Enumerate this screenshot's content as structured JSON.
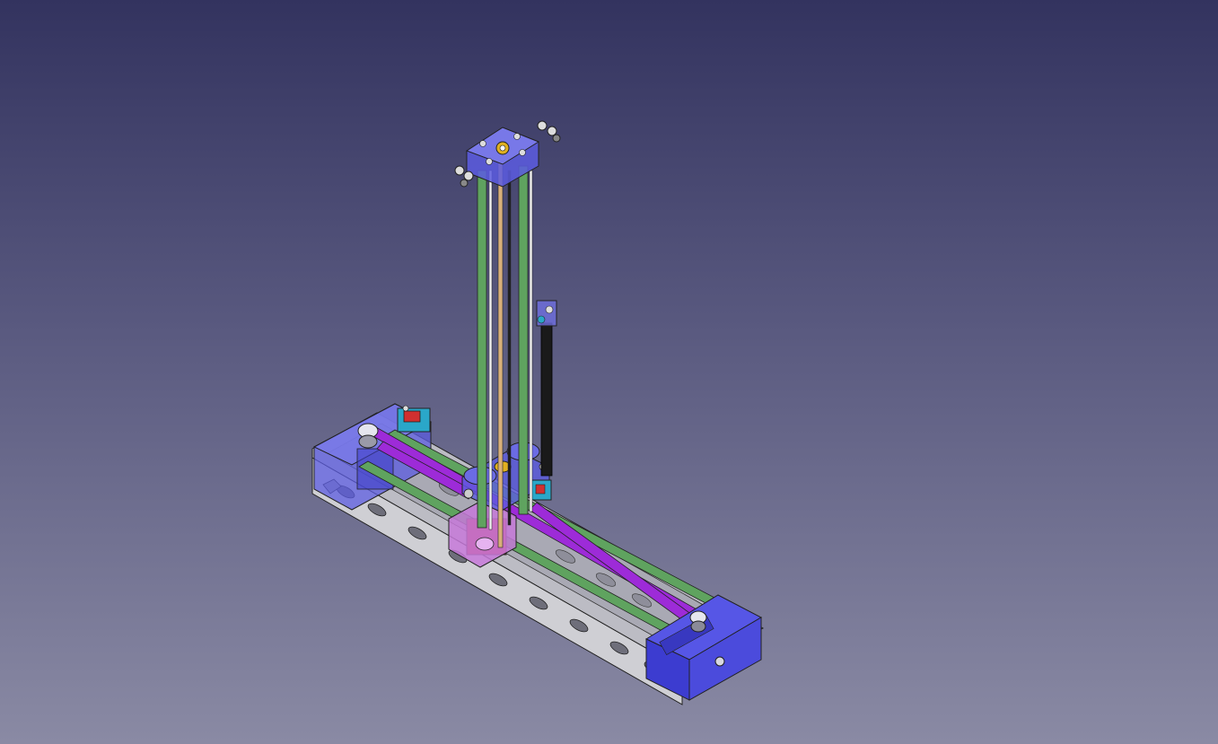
{
  "viewport": {
    "background_top": "#33335f",
    "background_bottom": "#8a8aa4"
  },
  "model": {
    "part_colors": {
      "frame_rail": "#c9c9cf",
      "enclosure_blue": "#4b4bdc",
      "transparent_blue": "#6f6fe0",
      "linear_rod_green": "#5fa35f",
      "belt_purple": "#9d2bd8",
      "lead_screw_tan": "#d8b07a",
      "motor_red": "#b8303a",
      "coupler_pink": "#c779d9",
      "endstop_cyan": "#2aa7c9",
      "endstop_red": "#d03030",
      "cable_black": "#1a1a1a"
    }
  }
}
